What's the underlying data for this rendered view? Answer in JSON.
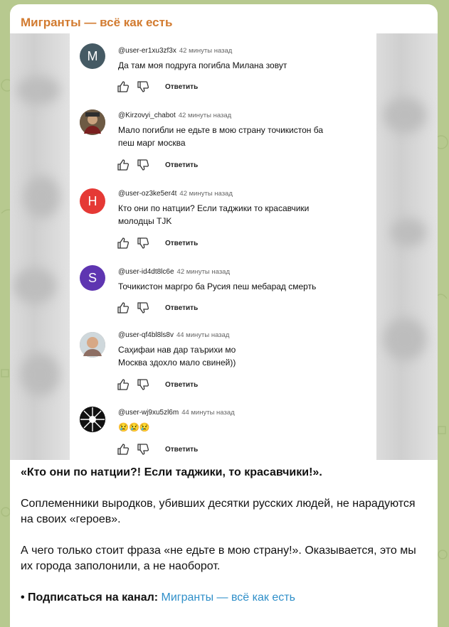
{
  "channel": {
    "name": "Мигранты — всё как есть"
  },
  "comments": [
    {
      "avatar_letter": "M",
      "avatar_color": "#455a64",
      "user": "@user-er1xu3zf3x",
      "time": "42 минуты назад",
      "lines": [
        "Да там моя подруга погибла Милана зовут"
      ],
      "reply": "Ответить"
    },
    {
      "avatar_letter": "",
      "avatar_color": "#5b4a3a",
      "user": "@Kirzovyi_chabot",
      "time": "42 минуты назад",
      "lines": [
        "Мало погибли не едьте в мою страну точикистон ба",
        "пеш марг москва"
      ],
      "reply": "Ответить"
    },
    {
      "avatar_letter": "H",
      "avatar_color": "#e53935",
      "user": "@user-oz3ke5er4t",
      "time": "42 минуты назад",
      "lines": [
        "Кто они по натции? Если таджики то красавчики",
        "молодцы TJK"
      ],
      "reply": "Ответить"
    },
    {
      "avatar_letter": "S",
      "avatar_color": "#5e35b1",
      "user": "@user-id4dt8lc6e",
      "time": "42 минуты назад",
      "lines": [
        "Точикистон маргро ба Русия пеш мебарад смерть"
      ],
      "reply": "Ответить"
    },
    {
      "avatar_letter": "",
      "avatar_color": "#a1887f",
      "user": "@user-qf4bl8ls8v",
      "time": "44 минуты назад",
      "lines": [
        "Саҳифаи нав дар таърихи мо",
        "Москва здохло мало свиней))"
      ],
      "reply": "Ответить"
    },
    {
      "avatar_letter": "",
      "avatar_color": "#111111",
      "user": "@user-wj9xu5zl6m",
      "time": "44 минуты назад",
      "lines": [
        "😢😢😢"
      ],
      "reply": "Ответить"
    }
  ],
  "post": {
    "headline": "«Кто они по натции?! Если таджики, то красавчики!».",
    "para1": "Соплеменники выродков, убивших десятки русских людей, не нарадуются на своих «героев».",
    "para2": "А чего только стоит фраза «не едьте в мою страну!». Оказывается, это мы их города заполонили, а не наоборот.",
    "subscribe_label": "• Подписаться на канал: ",
    "subscribe_link": "Мигранты — всё как есть"
  }
}
